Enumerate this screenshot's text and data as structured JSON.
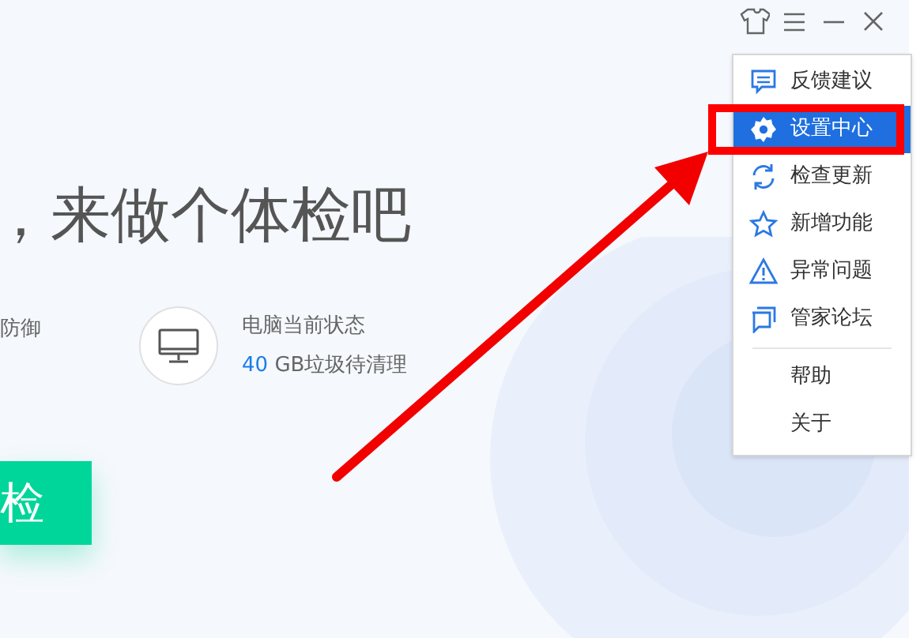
{
  "title_bar": {
    "controls": [
      {
        "kind": "skin"
      },
      {
        "kind": "menu"
      },
      {
        "kind": "minimize"
      },
      {
        "kind": "close"
      }
    ]
  },
  "headline": "，来做个体检吧",
  "protection": {
    "text": "防御"
  },
  "status": {
    "title": "电脑当前状态",
    "amount": "40",
    "detail": "GB垃圾待清理"
  },
  "scan_button": {
    "label": "检"
  },
  "menu": {
    "items": [
      {
        "kind": "feedback",
        "label": "反馈建议",
        "selected": false
      },
      {
        "kind": "settings",
        "label": "设置中心",
        "selected": true
      },
      {
        "kind": "update",
        "label": "检查更新",
        "selected": false
      },
      {
        "kind": "new",
        "label": "新增功能",
        "selected": false
      },
      {
        "kind": "problem",
        "label": "异常问题",
        "selected": false
      },
      {
        "kind": "forum",
        "label": "管家论坛",
        "selected": false
      },
      {
        "kind": "divider"
      },
      {
        "kind": "plain",
        "label": "帮助",
        "selected": false
      },
      {
        "kind": "plain",
        "label": "关于",
        "selected": false
      }
    ]
  }
}
